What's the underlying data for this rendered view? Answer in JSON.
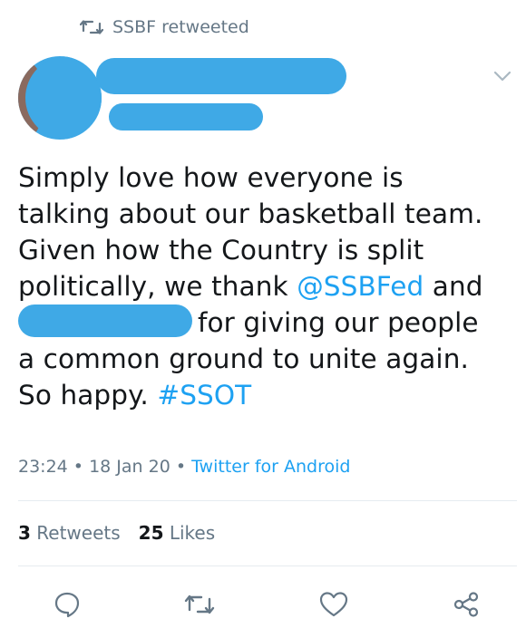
{
  "retweet_header": {
    "icon": "retweet-icon",
    "text": "SSBF retweeted"
  },
  "author": {
    "avatar": "avatar-redacted",
    "name": "",
    "handle": ""
  },
  "tweet": {
    "line_1": "Simply love how everyone is",
    "line_2": "talking about our basketball team.",
    "line_3": "Given how the Country is split",
    "line_4_text": "politically, we thank ",
    "line_4_mention": "@SSBFed",
    "line_4_end": " and",
    "line_5_end": "for giving our people",
    "line_6": "a common ground to unite again.",
    "line_7_text": "So happy. ",
    "line_7_hashtag": "#SSOT"
  },
  "meta": {
    "time": "23:24",
    "separator_1": " • ",
    "date": "18 Jan 20",
    "separator_2": " • ",
    "source": "Twitter for Android"
  },
  "stats": {
    "retweets_count": "3",
    "retweets_label": " Retweets",
    "likes_count": "25",
    "likes_label": " Likes"
  },
  "actions": [
    "reply-icon",
    "retweet-icon",
    "like-icon",
    "share-icon"
  ],
  "colors": {
    "link": "#1da1f2",
    "muted": "#657786",
    "text": "#14171a",
    "redaction": "#3fa9e6"
  }
}
